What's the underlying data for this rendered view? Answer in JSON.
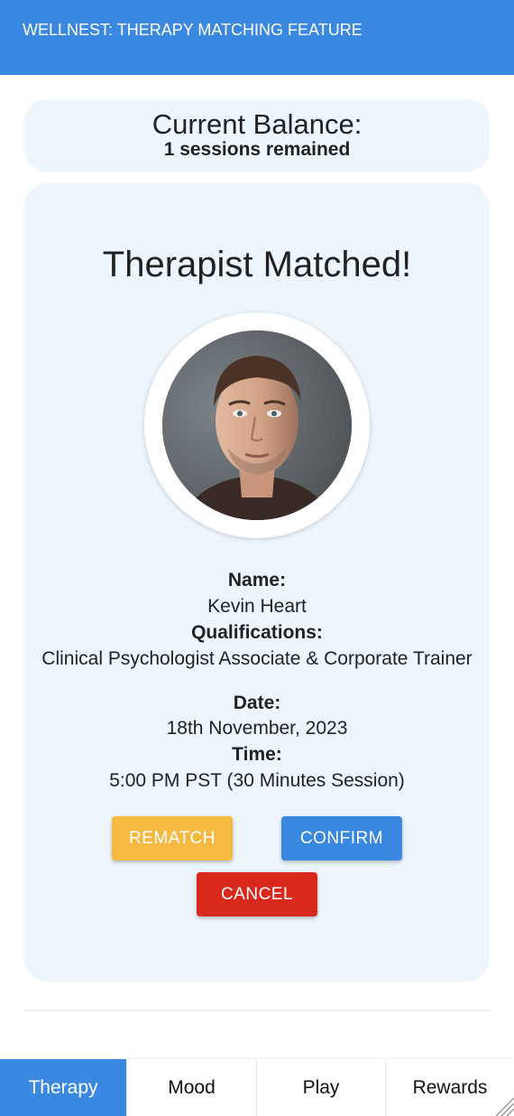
{
  "header": {
    "title": "WELLNEST: THERAPY MATCHING FEATURE"
  },
  "balance": {
    "title": "Current Balance:",
    "subtitle": "1 sessions remained"
  },
  "match": {
    "title": "Therapist Matched!",
    "name_label": "Name:",
    "name": "Kevin Heart",
    "qualifications_label": "Qualifications:",
    "qualifications": "Clinical Psychologist Associate & Corporate Trainer",
    "date_label": "Date:",
    "date": "18th November, 2023",
    "time_label": "Time:",
    "time": "5:00 PM PST (30 Minutes Session)"
  },
  "buttons": {
    "rematch": "REMATCH",
    "confirm": "CONFIRM",
    "cancel": "CANCEL"
  },
  "nav": {
    "items": [
      "Therapy",
      "Mood",
      "Play",
      "Rewards"
    ],
    "active": "Therapy"
  },
  "colors": {
    "primary": "#3a88e0",
    "card_bg": "#edf5fd",
    "rematch": "#f5b942",
    "cancel": "#d9291c"
  }
}
